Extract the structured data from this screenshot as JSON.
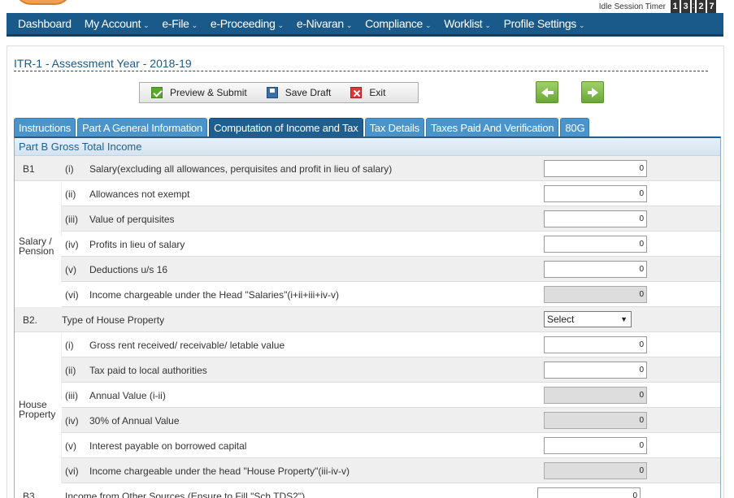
{
  "session": {
    "timer_label": "Idle Session Timer",
    "digits": [
      "1",
      "3",
      "2",
      "7"
    ],
    "separator": ":"
  },
  "nav": {
    "items": [
      {
        "label": "Dashboard",
        "has_menu": false
      },
      {
        "label": "My Account",
        "has_menu": true
      },
      {
        "label": "e-File",
        "has_menu": true
      },
      {
        "label": "e-Proceeding",
        "has_menu": true
      },
      {
        "label": "e-Nivaran",
        "has_menu": true
      },
      {
        "label": "Compliance",
        "has_menu": true
      },
      {
        "label": "Worklist",
        "has_menu": true
      },
      {
        "label": "Profile Settings",
        "has_menu": true
      }
    ],
    "caret": "⌄"
  },
  "form": {
    "title": "ITR-1 - Assessment Year - 2018-19"
  },
  "toolbar": {
    "preview_label": "Preview & Submit",
    "save_label": "Save Draft",
    "exit_label": "Exit",
    "icons": {
      "preview": "check-icon",
      "save": "floppy-disk-icon",
      "exit": "close-icon"
    }
  },
  "navigation_arrows": {
    "prev": "arrow-left-icon",
    "next": "arrow-right-icon"
  },
  "tabs": [
    {
      "label": "Instructions",
      "active": false
    },
    {
      "label": "Part A General Information",
      "active": false
    },
    {
      "label": "Computation of Income and Tax",
      "active": true
    },
    {
      "label": "Tax Details",
      "active": false
    },
    {
      "label": "Taxes Paid And Verification",
      "active": false
    },
    {
      "label": "80G",
      "active": false
    }
  ],
  "section": {
    "title": "Part B Gross Total Income"
  },
  "groups": {
    "salary": "Salary / Pension",
    "house": "House Property"
  },
  "rows": [
    {
      "code": "B1",
      "num": "(i)",
      "label": "Salary(excluding all allowances, perquisites and profit in lieu of salary)",
      "value": "0",
      "readonly": false
    },
    {
      "code": "",
      "num": "(ii)",
      "label": "Allowances not exempt",
      "value": "0",
      "readonly": false
    },
    {
      "code": "",
      "num": "(iii)",
      "label": "Value of perquisites",
      "value": "0",
      "readonly": false
    },
    {
      "code": "",
      "num": "(iv)",
      "label": "Profits in lieu of salary",
      "value": "0",
      "readonly": false
    },
    {
      "code": "",
      "num": "(v)",
      "label": "Deductions u/s 16",
      "value": "0",
      "readonly": false
    },
    {
      "code": "",
      "num": "(vi)",
      "label": "Income chargeable under the Head \"Salaries\"(i+ii+iii+iv-v)",
      "value": "0",
      "readonly": true
    },
    {
      "code": "B2.",
      "num": "",
      "label": "Type of House Property",
      "select": "Select"
    },
    {
      "code": "",
      "num": "(i)",
      "label": "Gross rent received/ receivable/ letable value",
      "value": "0",
      "readonly": false
    },
    {
      "code": "",
      "num": "(ii)",
      "label": "Tax paid to local authorities",
      "value": "0",
      "readonly": false
    },
    {
      "code": "",
      "num": "(iii)",
      "label": "Annual Value (i-ii)",
      "value": "0",
      "readonly": true
    },
    {
      "code": "",
      "num": "(iv)",
      "label": "30% of Annual Value",
      "value": "0",
      "readonly": true
    },
    {
      "code": "",
      "num": "(v)",
      "label": "Interest payable on borrowed capital",
      "value": "0",
      "readonly": false
    },
    {
      "code": "",
      "num": "(vi)",
      "label": "Income chargeable under the head \"House Property\"(iii-iv-v)",
      "value": "0",
      "readonly": true
    },
    {
      "code": "B3.",
      "num": "",
      "label": "Income from Other Sources (Ensure to Fill \"Sch TDS2\")",
      "value": "0",
      "readonly": false
    }
  ]
}
